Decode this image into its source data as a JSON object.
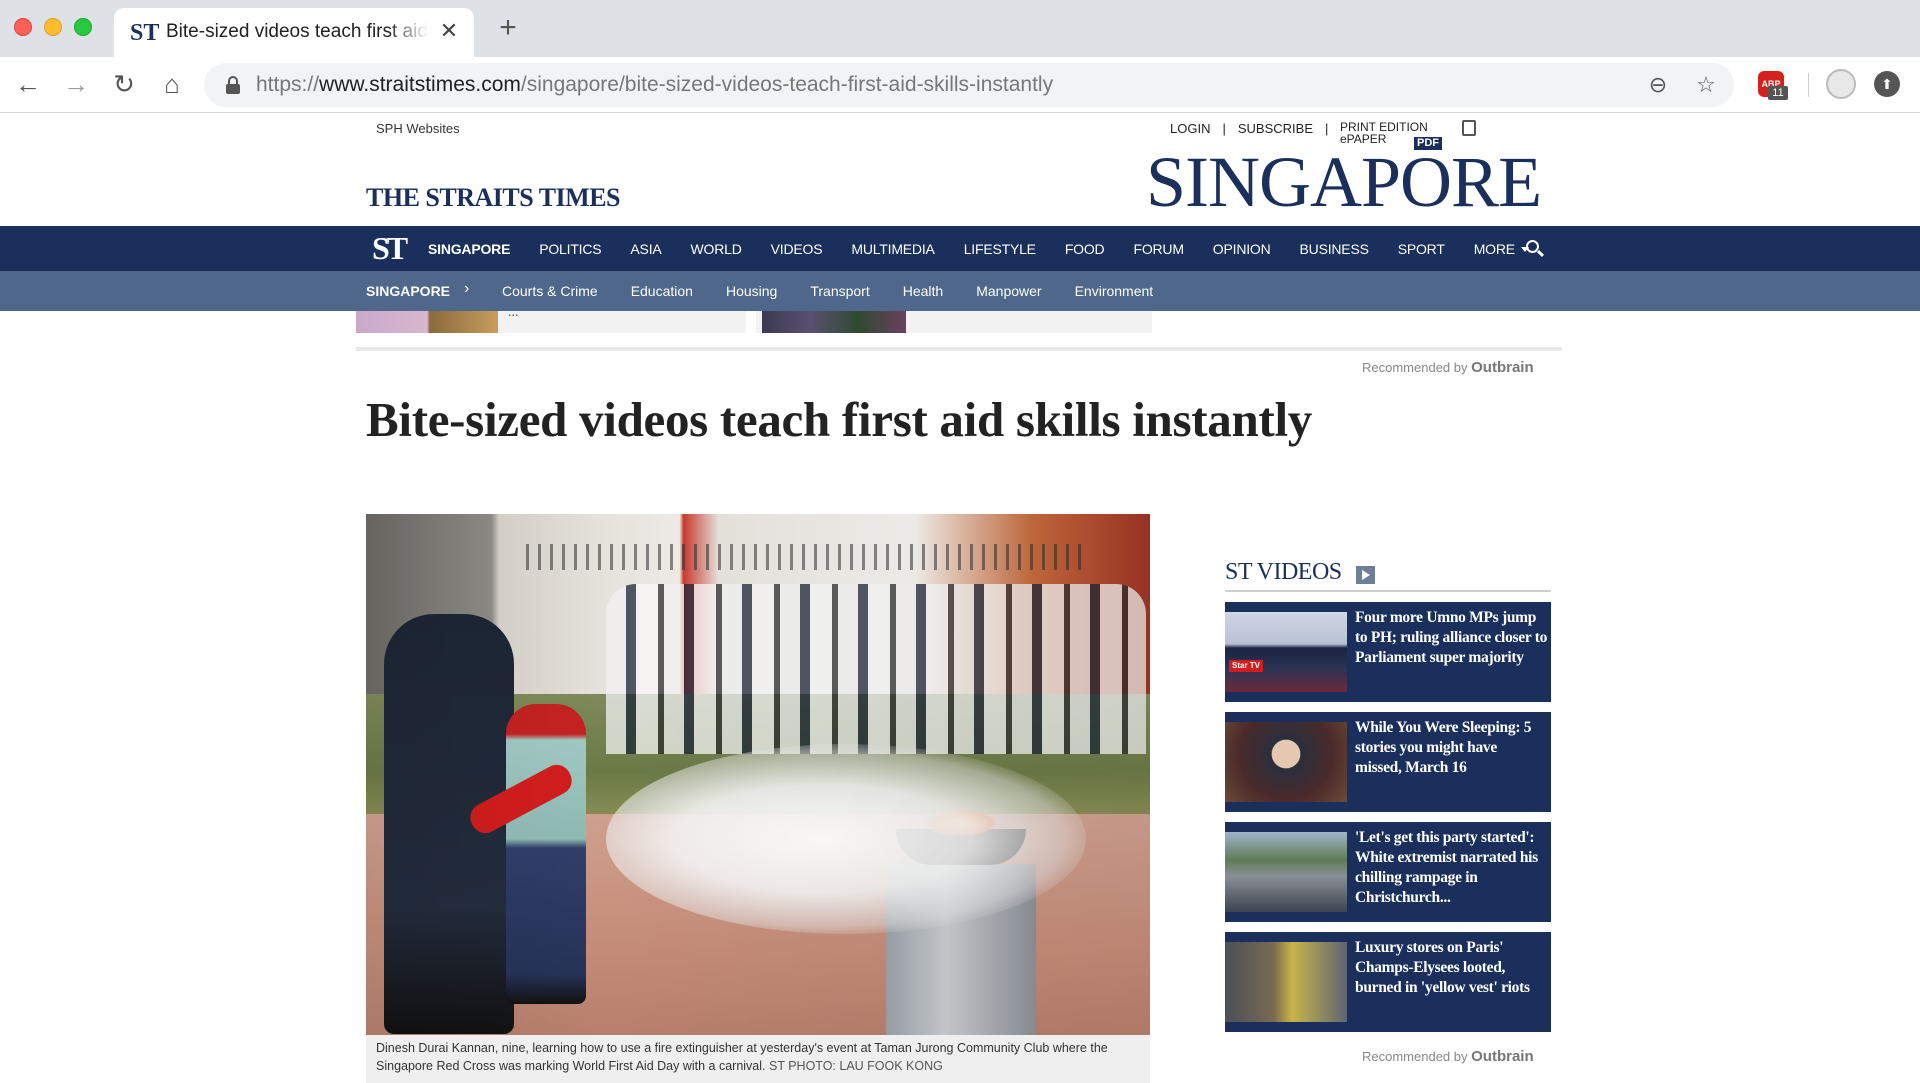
{
  "browser": {
    "tab_title": "Bite-sized videos teach first aid skills instantly",
    "tab_favicon": "ST",
    "close_glyph": "✕",
    "new_tab_glyph": "+",
    "back_glyph": "←",
    "forward_glyph": "→",
    "reload_glyph": "↻",
    "home_glyph": "⌂",
    "url_scheme": "https://",
    "url_host": "www.straitstimes.com",
    "url_path": "/singapore/bite-sized-videos-teach-first-aid-skills-instantly",
    "zoom_glyph": "⊖",
    "star_glyph": "☆",
    "ext_abp_label": "ABP",
    "ext_abp_count": "11",
    "menu_glyph": "⬆",
    "icons": [
      "back-icon",
      "forward-icon",
      "reload-icon",
      "home-icon",
      "lock-icon",
      "zoom-icon",
      "star-icon",
      "adblock-icon",
      "profile-icon",
      "menu-icon"
    ]
  },
  "header": {
    "sph_websites": "SPH Websites",
    "login": "LOGIN",
    "subscribe": "SUBSCRIBE",
    "divider": "|",
    "print_edition": "PRINT EDITION",
    "epaper": "ePAPER",
    "pdf": "PDF",
    "logo": "THE STRAITS TIMES",
    "section": "SINGAPORE"
  },
  "mainnav": {
    "st_mark": "ST",
    "items": [
      "SINGAPORE",
      "POLITICS",
      "ASIA",
      "WORLD",
      "VIDEOS",
      "MULTIMEDIA",
      "LIFESTYLE",
      "FOOD",
      "FORUM",
      "OPINION",
      "BUSINESS",
      "SPORT",
      "MORE"
    ]
  },
  "subnav": {
    "home": "SINGAPORE",
    "chevron": "›",
    "items": [
      "Courts & Crime",
      "Education",
      "Housing",
      "Transport",
      "Health",
      "Manpower",
      "Environment"
    ]
  },
  "recommended": {
    "card1_text": "...",
    "card2_text": "",
    "by_label": "Recommended by",
    "by_brand": "Outbrain"
  },
  "article": {
    "headline": "Bite-sized videos teach first aid skills instantly",
    "caption": "Dinesh Durai Kannan, nine, learning how to use a fire extinguisher at yesterday's event at Taman Jurong Community Club where the Singapore Red Cross was marking World First Aid Day with a carnival.",
    "credit": "ST PHOTO: LAU FOOK KONG"
  },
  "videos": {
    "heading": "ST VIDEOS",
    "items": [
      {
        "title": "Four more Umno MPs jump to PH; ruling alliance closer to Parliament super majority",
        "badge": "Star TV"
      },
      {
        "title": "While You Were Sleeping: 5 stories you might have missed, March 16"
      },
      {
        "title": "'Let's get this party started': White extremist narrated his chilling rampage in Christchurch..."
      },
      {
        "title": "Luxury stores on Paris' Champs-Elysees looted, burned in 'yellow vest' riots"
      }
    ],
    "rec_label": "Recommended by",
    "rec_brand": "Outbrain"
  },
  "colors": {
    "navy": "#1a2f5c",
    "subnav": "#4e678a",
    "tabbar": "#dee1e6"
  }
}
